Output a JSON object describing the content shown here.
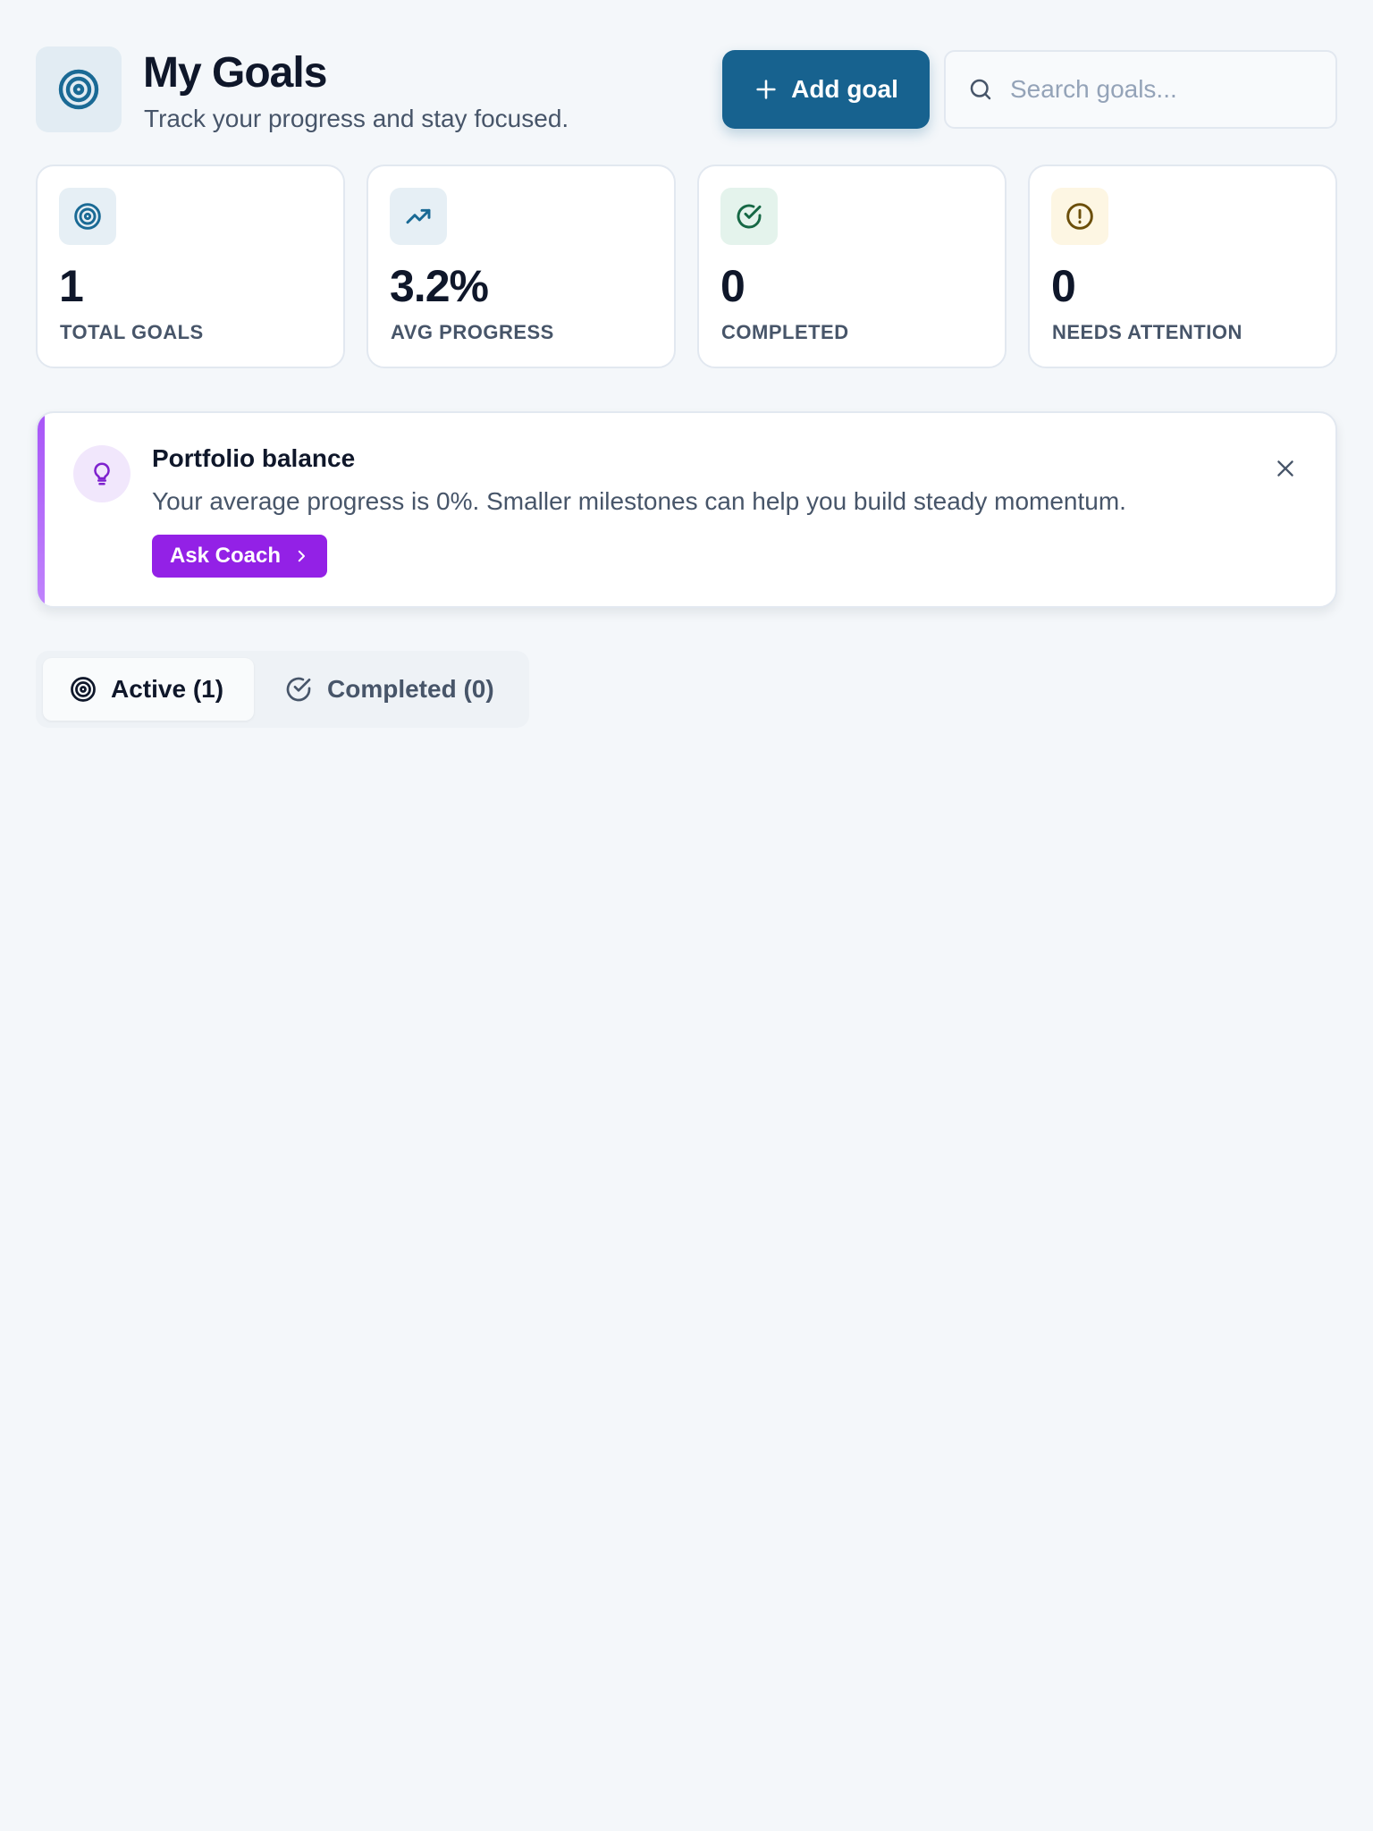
{
  "header": {
    "logo_icon": "target-icon",
    "title": "My Goals",
    "subtitle": "Track your progress and stay focused.",
    "add_button_label": "Add goal",
    "search_placeholder": "Search goals..."
  },
  "stats": [
    {
      "icon": "target-icon",
      "value": "1",
      "label": "TOTAL GOALS",
      "icon_bg": "#e6eff5",
      "icon_color": "#1a6a95"
    },
    {
      "icon": "trending-up-icon",
      "value": "3.2%",
      "label": "AVG PROGRESS",
      "icon_bg": "#e6eff5",
      "icon_color": "#1a6a95"
    },
    {
      "icon": "check-circle-icon",
      "value": "0",
      "label": "COMPLETED",
      "icon_bg": "#e4f3ec",
      "icon_color": "#166845"
    },
    {
      "icon": "alert-circle-icon",
      "value": "0",
      "label": "NEEDS ATTENTION",
      "icon_bg": "#fdf6e3",
      "icon_color": "#6b4e0a"
    }
  ],
  "coach": {
    "title": "Portfolio balance",
    "message": "Your average progress is 0%. Smaller milestones can help you build steady momentum.",
    "button_label": "Ask Coach",
    "accent_color": "#9321e6"
  },
  "tabs": [
    {
      "label": "Active (1)",
      "icon": "target-icon",
      "active": true
    },
    {
      "label": "Completed (0)",
      "icon": "check-circle-icon",
      "active": false
    }
  ],
  "colors": {
    "background": "#f4f7fa",
    "primary": "#17628f",
    "coach_accent": "#9321e6"
  }
}
